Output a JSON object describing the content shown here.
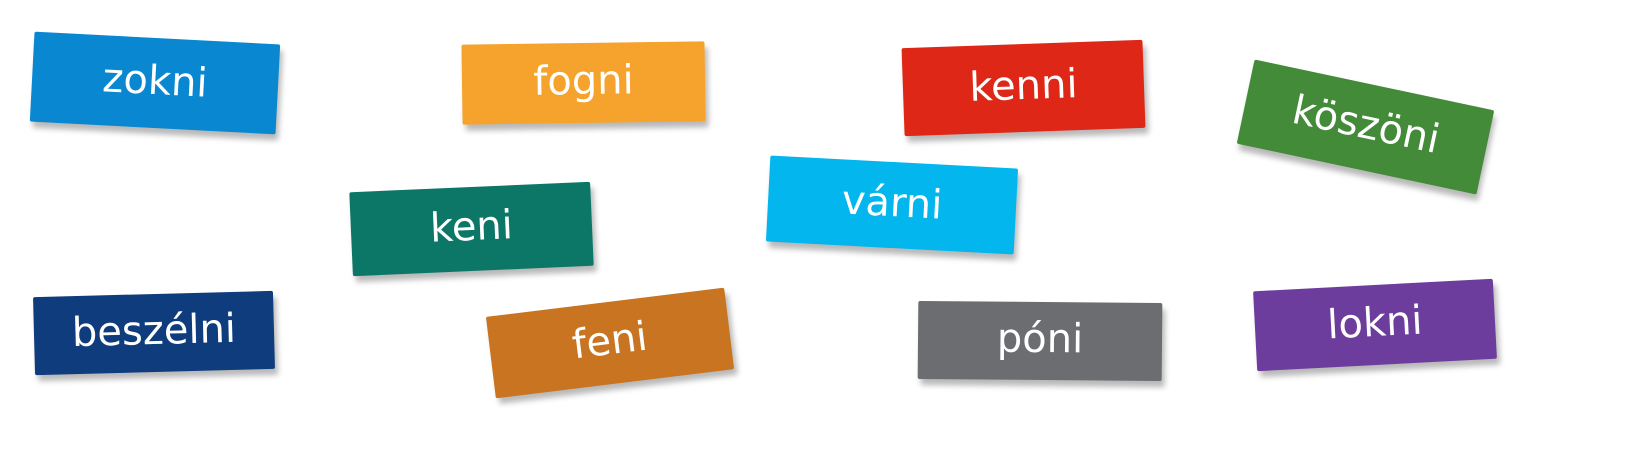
{
  "words": [
    {
      "label": "zokni",
      "color": "#0a87d1"
    },
    {
      "label": "fogni",
      "color": "#f6a32d"
    },
    {
      "label": "kenni",
      "color": "#df2717"
    },
    {
      "label": "köszöni",
      "color": "#438a39"
    },
    {
      "label": "keni",
      "color": "#0c7767"
    },
    {
      "label": "várni",
      "color": "#03b6ee"
    },
    {
      "label": "beszélni",
      "color": "#0e3c7c"
    },
    {
      "label": "feni",
      "color": "#c87421"
    },
    {
      "label": "póni",
      "color": "#6c6d71"
    },
    {
      "label": "lokni",
      "color": "#6d3d9e"
    }
  ]
}
